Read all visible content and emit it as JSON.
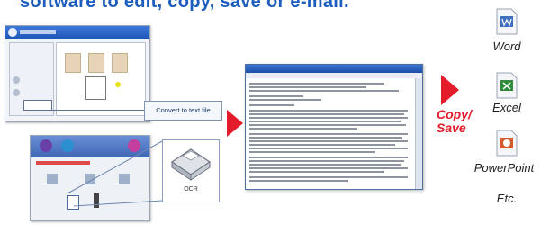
{
  "headline": "software to edit, copy, save or e-mail.",
  "callouts": {
    "convert_label": "Convert to text file",
    "ocr_label": "OCR"
  },
  "copy_save": {
    "line1": "Copy/",
    "line2": "Save"
  },
  "apps": [
    {
      "label": "Word",
      "icon": "word-icon",
      "color": "#3f6fc0"
    },
    {
      "label": "Excel",
      "icon": "excel-icon",
      "color": "#2f8a3a"
    },
    {
      "label": "PowerPoint",
      "icon": "powerpoint-icon",
      "color": "#d65a2c"
    },
    {
      "label": "Etc.",
      "icon": "",
      "color": ""
    }
  ],
  "colors": {
    "headline": "#1c5dbd",
    "accent_red": "#e41b2a"
  }
}
